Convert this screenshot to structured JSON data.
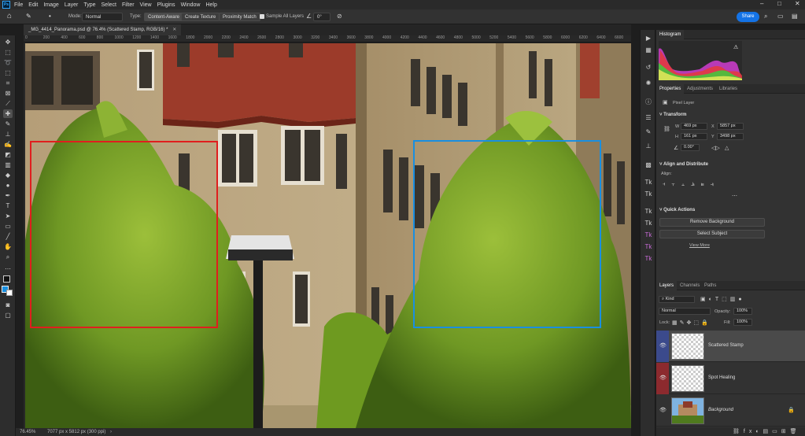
{
  "app": {
    "logo": "Ps"
  },
  "menubar": {
    "items": [
      "File",
      "Edit",
      "Image",
      "Layer",
      "Type",
      "Select",
      "Filter",
      "View",
      "Plugins",
      "Window",
      "Help"
    ]
  },
  "options": {
    "mode_label": "Mode:",
    "mode_value": "Normal",
    "type_label": "Type:",
    "type_content_aware": "Content-Aware",
    "type_create_texture": "Create Texture",
    "type_proximity_match": "Proximity Match",
    "sample_all_layers": "Sample All Layers",
    "angle_value": "0°",
    "share_label": "Share"
  },
  "document": {
    "tab_title": "_MG_4414_Panorama.psd @ 76.4% (Scattered Stamp, RGB/16) *",
    "ruler_ticks": [
      "0",
      "200",
      "400",
      "600",
      "800",
      "1000",
      "1200",
      "1400",
      "1600",
      "1800",
      "2000",
      "2200",
      "2400",
      "2600",
      "2800",
      "3000",
      "3200",
      "3400",
      "3600",
      "3800",
      "4000",
      "4200",
      "4400",
      "4600",
      "4800",
      "5000",
      "5200",
      "5400",
      "5600",
      "5800",
      "6000",
      "6200",
      "6400",
      "6600"
    ]
  },
  "status": {
    "zoom": "76.45%",
    "doc_size": "7077 px x 5812 px (300 ppi)"
  },
  "histogram": {
    "tab": "Histogram"
  },
  "properties": {
    "tabs": [
      "Properties",
      "Adjustments",
      "Libraries"
    ],
    "layer_kind": "Pixel Layer",
    "transform_title": "Transform",
    "w_label": "W",
    "w_value": "469 px",
    "x_label": "X",
    "x_value": "5857 px",
    "h_label": "H",
    "h_value": "161 px",
    "y_label": "Y",
    "y_value": "3498 px",
    "angle_value": "0.00°",
    "align_title": "Align and Distribute",
    "align_label": "Align:",
    "quick_actions_title": "Quick Actions",
    "remove_background": "Remove Background",
    "select_subject": "Select Subject",
    "view_more": "View More"
  },
  "layers": {
    "tabs": [
      "Layers",
      "Channels",
      "Paths"
    ],
    "filter_kind": "Kind",
    "blend_mode": "Normal",
    "opacity_label": "Opacity:",
    "opacity_value": "100%",
    "lock_label": "Lock:",
    "fill_label": "Fill:",
    "fill_value": "100%",
    "items": [
      {
        "name": "Scattered Stamp",
        "color": "#3b4a8c",
        "selected": true
      },
      {
        "name": "Spot Healing",
        "color": "#8c2a2e",
        "selected": false
      },
      {
        "name": "Background",
        "color": "",
        "selected": false,
        "locked": true
      }
    ]
  },
  "colors": {
    "red_box": "#e01e1e",
    "blue_box": "#1a8fe0",
    "accent": "#1473e6"
  }
}
